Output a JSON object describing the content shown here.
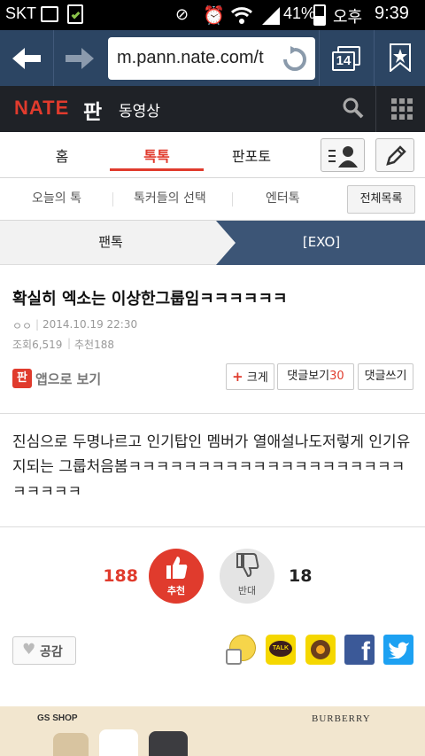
{
  "status_bar": {
    "carrier": "SKT",
    "battery": "41%",
    "time_prefix": "오후",
    "time": "9:39"
  },
  "browser": {
    "url": "m.pann.nate.com/t",
    "tab_count": "14"
  },
  "nate_header": {
    "logo": "NATE",
    "section": "판",
    "menu": "동영상"
  },
  "main_tabs": [
    "홈",
    "톡톡",
    "판포토"
  ],
  "sub_nav": [
    "오늘의 톡",
    "톡커들의 선택",
    "엔터톡"
  ],
  "all_list_label": "전체목록",
  "breadcrumb": {
    "parent": "팬톡",
    "current": "[EXO]"
  },
  "post": {
    "title": "확실히 엑소는 이상한그룹임ㅋㅋㅋㅋㅋㅋ",
    "author": "ㅇㅇ",
    "date": "2014.10.19 22:30",
    "views": "조회6,519",
    "recommends": "추천188",
    "app_view": "앱으로 보기",
    "app_icon_text": "판",
    "body": "진심으로 두명나르고 인기탑인 멤버가 열애설나도저렇게 인기유지되는 그룹처음봄ㅋㅋㅋㅋㅋㅋㅋㅋㅋㅋㅋㅋㅋㅋㅋㅋㅋㅋㅋㅋㅋㅋㅋㅋㅋ"
  },
  "post_buttons": {
    "enlarge": "크게",
    "view_comments": "댓글보기",
    "comment_count": "30",
    "write_comment": "댓글쓰기"
  },
  "votes": {
    "up_count": "188",
    "up_label": "추천",
    "down_label": "반대",
    "down_count": "18"
  },
  "empathy_label": "공감",
  "share_icons": [
    "emoticon",
    "kakaotalk",
    "kakaostory",
    "facebook",
    "twitter"
  ],
  "ad": {
    "left": "GS SHOP",
    "right": "BURBERRY"
  },
  "colors": {
    "accent_red": "#e03b2d",
    "nav_blue": "#3c5576",
    "facebook": "#3b5998",
    "twitter": "#1da1f2"
  }
}
